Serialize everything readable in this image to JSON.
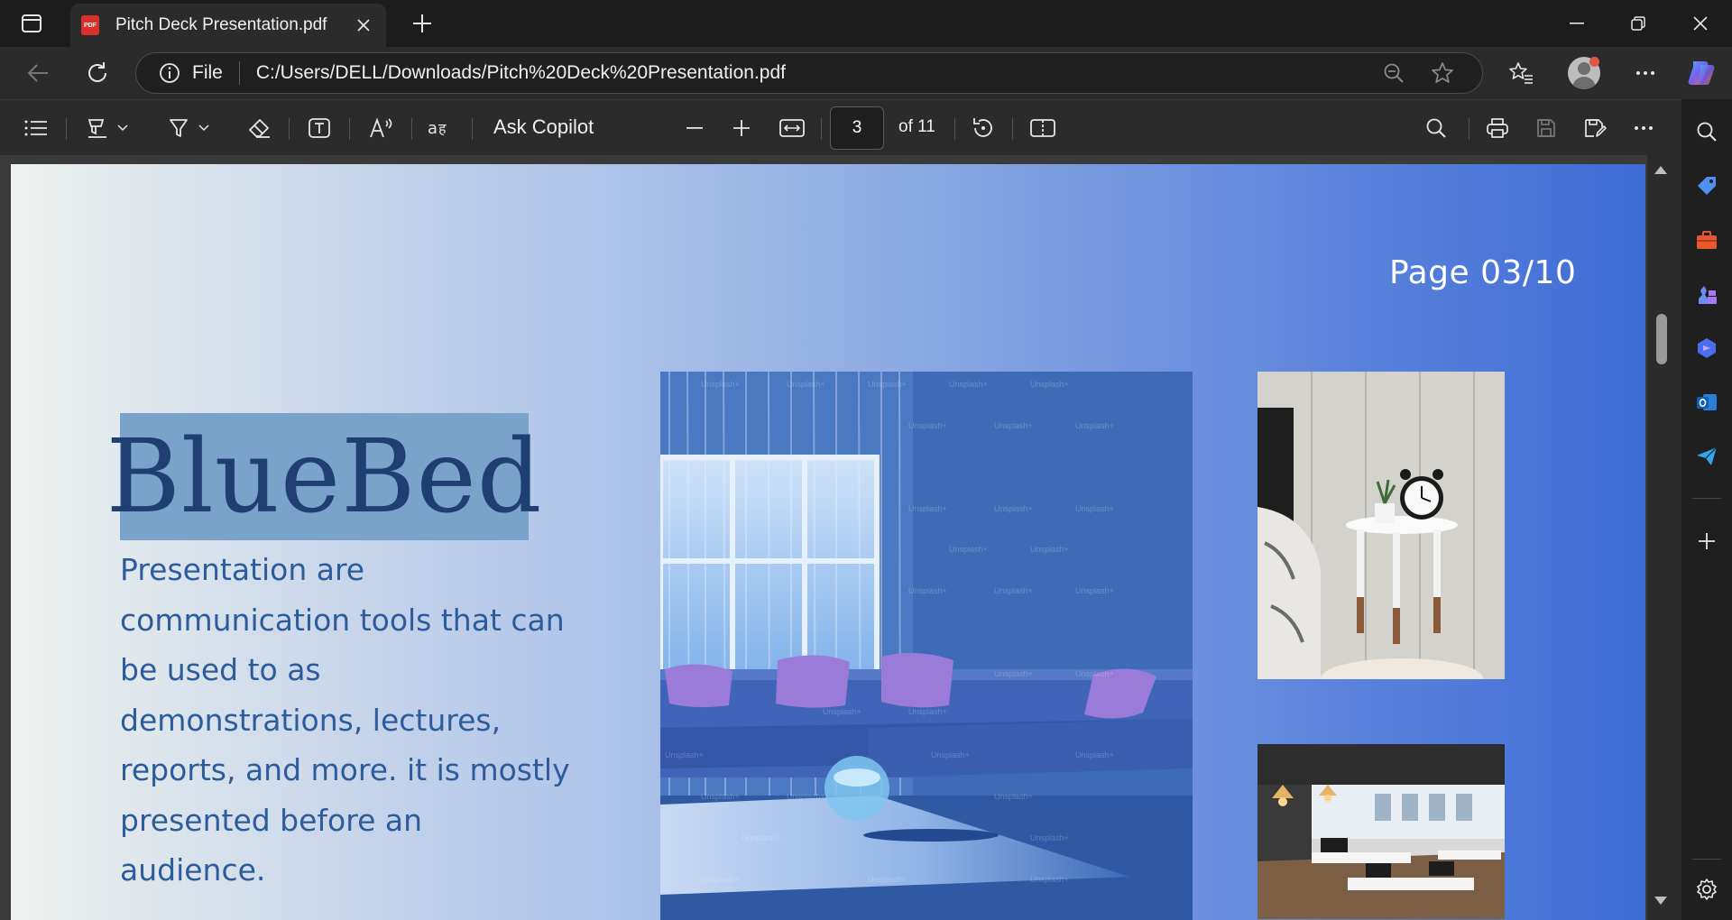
{
  "browser": {
    "tab": {
      "title": "Pitch Deck Presentation.pdf",
      "favicon_label": "PDF"
    },
    "address": {
      "scheme_label": "File",
      "url": "C:/Users/DELL/Downloads/Pitch%20Deck%20Presentation.pdf"
    },
    "icons": [
      "tab-actions-icon",
      "pdf-icon",
      "close-icon",
      "plus-icon",
      "minimize-icon",
      "restore-icon",
      "close-window-icon",
      "back-arrow-icon",
      "refresh-icon",
      "info-icon",
      "zoom-out-icon",
      "star-icon",
      "favorites-icon",
      "avatar",
      "more-icon",
      "copilot-icon"
    ]
  },
  "pdf_toolbar": {
    "ask_copilot": "Ask Copilot",
    "current_page": "3",
    "page_count_label": "of 11",
    "icons": [
      "contents-icon",
      "highlight-icon",
      "draw-icon",
      "erase-icon",
      "text-box-icon",
      "read-aloud-icon",
      "translate-icon",
      "zoom-out-icon",
      "zoom-in-icon",
      "fit-width-icon",
      "rotate-icon",
      "page-view-icon",
      "search-icon",
      "print-icon",
      "save-icon",
      "save-as-icon",
      "more-icon"
    ]
  },
  "sidebar": {
    "icons": [
      "search-icon",
      "tag-icon",
      "toolbox-icon",
      "games-icon",
      "copilot-icon",
      "outlook-icon",
      "send-icon",
      "add-icon",
      "settings-icon"
    ]
  },
  "document": {
    "page_label": "Page 03/10",
    "title": "BlueBed",
    "body": "Presentation are communication tools that can be used to as demonstrations, lectures, reports, and more. it is mostly presented before an audience.",
    "watermark": "Unsplash+"
  },
  "colors": {
    "title_text": "#1f3f73",
    "title_highlight": "#7aa3cb",
    "body_text": "#2c5c9c",
    "page_gradient_end": "#3e6bd6"
  }
}
